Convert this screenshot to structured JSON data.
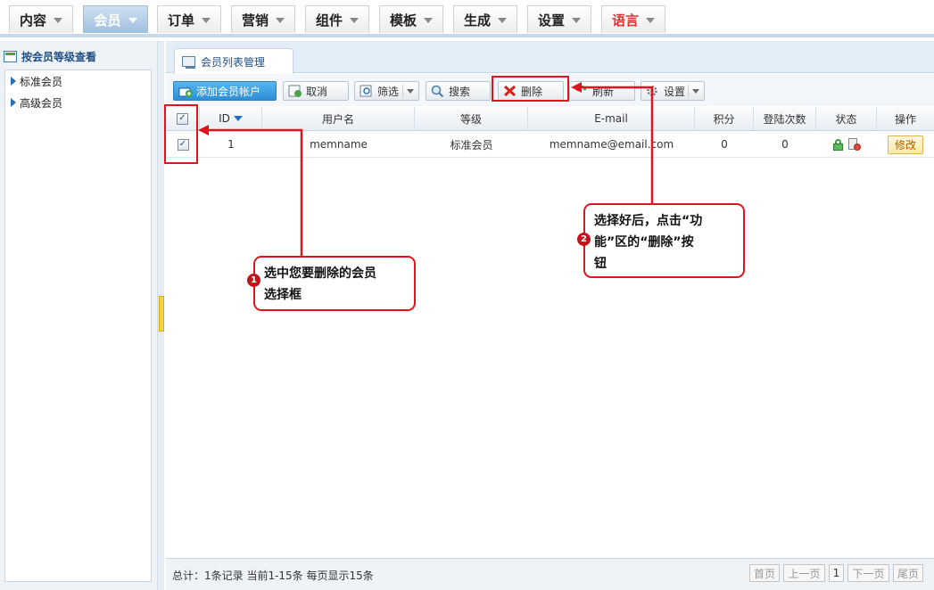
{
  "nav": {
    "tabs": [
      {
        "label": "内容",
        "active": false
      },
      {
        "label": "会员",
        "active": true
      },
      {
        "label": "订单",
        "active": false
      },
      {
        "label": "营销",
        "active": false
      },
      {
        "label": "组件",
        "active": false
      },
      {
        "label": "模板",
        "active": false
      },
      {
        "label": "生成",
        "active": false
      },
      {
        "label": "设置",
        "active": false
      },
      {
        "label": "语言",
        "active": false
      }
    ]
  },
  "sidebar": {
    "title": "按会员等级查看",
    "items": [
      {
        "label": "标准会员"
      },
      {
        "label": "高级会员"
      }
    ]
  },
  "main": {
    "page_tab": "会员列表管理",
    "toolbar": {
      "add": "添加会员帐户",
      "cancel": "取消",
      "filter": "筛选",
      "search": "搜索",
      "delete": "删除",
      "refresh": "刷新",
      "settings": "设置"
    },
    "columns": {
      "id": "ID",
      "username": "用户名",
      "level": "等级",
      "email": "E-mail",
      "points": "积分",
      "logins": "登陆次数",
      "status": "状态",
      "actions": "操作"
    },
    "rows": [
      {
        "id": "1",
        "username": "memname",
        "level": "标准会员",
        "email": "memname@email.com",
        "points": "0",
        "logins": "0",
        "checked": true,
        "action": "修改"
      }
    ],
    "footer": {
      "summary": "总计：1条记录 当前1-15条 每页显示15条",
      "first": "首页",
      "prev": "上一页",
      "page": "1",
      "next": "下一页",
      "last": "尾页"
    }
  },
  "annotations": {
    "step1": {
      "number": "1",
      "text_line1": "选中您要删除的会员",
      "text_line2": "选择框"
    },
    "step2": {
      "number": "2",
      "text_line1": "选择好后，点击“功",
      "text_line2": "能”区的“删除”按",
      "text_line3": "钮"
    }
  },
  "colors": {
    "annotation_red": "#e0141e",
    "active_tab": "#9fbfe0",
    "language_tab_text": "#dd3333"
  }
}
